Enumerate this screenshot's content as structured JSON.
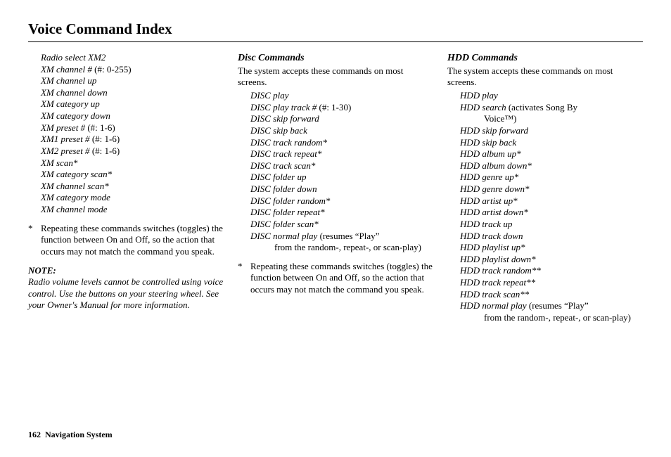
{
  "title": "Voice Command Index",
  "col1": {
    "commands": [
      {
        "cmd": "Radio select XM2",
        "plain": ""
      },
      {
        "cmd": "XM channel #",
        "plain": " (#: 0-255)"
      },
      {
        "cmd": "XM channel up",
        "plain": ""
      },
      {
        "cmd": "XM channel down",
        "plain": ""
      },
      {
        "cmd": "XM category up",
        "plain": ""
      },
      {
        "cmd": "XM category down",
        "plain": ""
      },
      {
        "cmd": "XM preset #",
        "plain": " (#: 1-6)"
      },
      {
        "cmd": "XM1 preset #",
        "plain": " (#: 1-6)"
      },
      {
        "cmd": "XM2 preset #",
        "plain": " (#: 1-6)"
      },
      {
        "cmd": "XM scan*",
        "plain": ""
      },
      {
        "cmd": "XM category scan*",
        "plain": ""
      },
      {
        "cmd": "XM channel scan*",
        "plain": ""
      },
      {
        "cmd": "XM category mode",
        "plain": ""
      },
      {
        "cmd": "XM channel mode",
        "plain": ""
      }
    ],
    "note_star": "*",
    "note_text": "Repeating these commands switches (toggles) the function between On and Off, so the action that occurs may not match the command you speak.",
    "note_head": "NOTE:",
    "note_body": "Radio volume levels cannot be controlled using voice control. Use the buttons on your steering wheel. See your Owner's Manual for more information."
  },
  "col2": {
    "heading": "Disc Commands",
    "intro": "The system accepts these commands on most screens.",
    "commands": [
      {
        "cmd": "DISC play",
        "plain": ""
      },
      {
        "cmd": "DISC play track #",
        "plain": " (#: 1-30)"
      },
      {
        "cmd": "DISC skip forward",
        "plain": ""
      },
      {
        "cmd": "DISC skip back",
        "plain": ""
      },
      {
        "cmd": "DISC track random*",
        "plain": ""
      },
      {
        "cmd": "DISC track repeat*",
        "plain": ""
      },
      {
        "cmd": "DISC track scan*",
        "plain": ""
      },
      {
        "cmd": "DISC folder up",
        "plain": ""
      },
      {
        "cmd": "DISC folder down",
        "plain": ""
      },
      {
        "cmd": "DISC folder random*",
        "plain": ""
      },
      {
        "cmd": "DISC folder repeat*",
        "plain": ""
      },
      {
        "cmd": "DISC folder scan*",
        "plain": ""
      },
      {
        "cmd": "DISC normal play",
        "plain": " (resumes “Play”",
        "cont": "from the random-, repeat-, or scan-play)"
      }
    ],
    "note_star": "*",
    "note_text": "Repeating these commands switches (toggles) the function between On and Off, so the action that occurs may not match the command you speak."
  },
  "col3": {
    "heading": "HDD Commands",
    "intro": "The system accepts these commands on most screens.",
    "commands": [
      {
        "cmd": "HDD play",
        "plain": ""
      },
      {
        "cmd": "HDD search",
        "plain": " (activates Song By",
        "cont": "Voice™)"
      },
      {
        "cmd": "HDD skip forward",
        "plain": ""
      },
      {
        "cmd": "HDD skip back",
        "plain": ""
      },
      {
        "cmd": "HDD album up*",
        "plain": ""
      },
      {
        "cmd": "HDD album down*",
        "plain": ""
      },
      {
        "cmd": "HDD genre up*",
        "plain": ""
      },
      {
        "cmd": "HDD genre down*",
        "plain": ""
      },
      {
        "cmd": "HDD artist up*",
        "plain": ""
      },
      {
        "cmd": "HDD artist down*",
        "plain": ""
      },
      {
        "cmd": "HDD track up",
        "plain": ""
      },
      {
        "cmd": "HDD track down",
        "plain": ""
      },
      {
        "cmd": "HDD playlist up*",
        "plain": ""
      },
      {
        "cmd": "HDD playlist down*",
        "plain": ""
      },
      {
        "cmd": "HDD track random**",
        "plain": ""
      },
      {
        "cmd": "HDD track repeat**",
        "plain": ""
      },
      {
        "cmd": "HDD track scan**",
        "plain": ""
      },
      {
        "cmd": "HDD normal play",
        "plain": " (resumes “Play”",
        "cont": "from the random-, repeat-, or scan-play)"
      }
    ]
  },
  "footer": {
    "page": "162",
    "label": "Navigation System"
  }
}
